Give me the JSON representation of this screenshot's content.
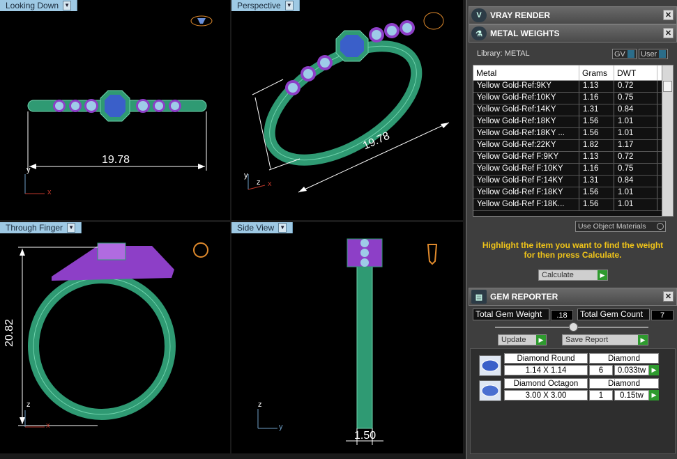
{
  "viewports": {
    "top_left": {
      "label": "Looking Down",
      "dimension": "19.78",
      "axis_x": "x",
      "axis_y": "y"
    },
    "top_right": {
      "label": "Perspective",
      "dimension": "19.78",
      "axis_x": "x",
      "axis_y": "y",
      "axis_z": "z"
    },
    "bottom_left": {
      "label": "Through Finger",
      "dimension": "20.82",
      "axis_x": "x",
      "axis_z": "z"
    },
    "bottom_right": {
      "label": "Side View",
      "dimension": "1.50",
      "axis_y": "y",
      "axis_z": "z"
    }
  },
  "panel": {
    "vray": {
      "title": "VRAY RENDER"
    },
    "metal": {
      "title": "METAL WEIGHTS",
      "library_label": "Library: METAL",
      "gv_label": "GV",
      "user_label": "User",
      "columns": [
        "Metal",
        "Grams",
        "DWT"
      ],
      "rows": [
        [
          "Yellow Gold-Ref:9KY",
          "1.13",
          "0.72"
        ],
        [
          "Yellow Gold-Ref:10KY",
          "1.16",
          "0.75"
        ],
        [
          "Yellow Gold-Ref:14KY",
          "1.31",
          "0.84"
        ],
        [
          "Yellow Gold-Ref:18KY",
          "1.56",
          "1.01"
        ],
        [
          "Yellow Gold-Ref:18KY ...",
          "1.56",
          "1.01"
        ],
        [
          "Yellow Gold-Ref:22KY",
          "1.82",
          "1.17"
        ],
        [
          "Yellow Gold-Ref F:9KY",
          "1.13",
          "0.72"
        ],
        [
          "Yellow Gold-Ref F:10KY",
          "1.16",
          "0.75"
        ],
        [
          "Yellow Gold-Ref F:14KY",
          "1.31",
          "0.84"
        ],
        [
          "Yellow Gold-Ref F:18KY",
          "1.56",
          "1.01"
        ],
        [
          "Yellow Gold-Ref F:18K...",
          "1.56",
          "1.01"
        ]
      ],
      "use_object_materials": "Use Object Materials",
      "hint_line1": "Highlight the item you want to find the weight",
      "hint_line2": "for then press Calculate.",
      "calculate_label": "Calculate"
    },
    "gem": {
      "title": "GEM REPORTER",
      "total_weight_label": "Total Gem Weight",
      "total_weight_value": ".18",
      "total_count_label": "Total Gem Count",
      "total_count_value": "7",
      "update_label": "Update",
      "save_label": "Save Report",
      "items": [
        {
          "name": "Diamond Round",
          "type": "Diamond",
          "size": "1.14 X 1.14",
          "count": "6",
          "weight": "0.033tw"
        },
        {
          "name": "Diamond Octagon",
          "type": "Diamond",
          "size": "3.00 X 3.00",
          "count": "1",
          "weight": "0.15tw"
        }
      ]
    }
  },
  "colors": {
    "band": "#2f9a73",
    "setting": "#8d3fc7",
    "stone": "#3a5fc9",
    "accent_text": "#f0c419"
  }
}
